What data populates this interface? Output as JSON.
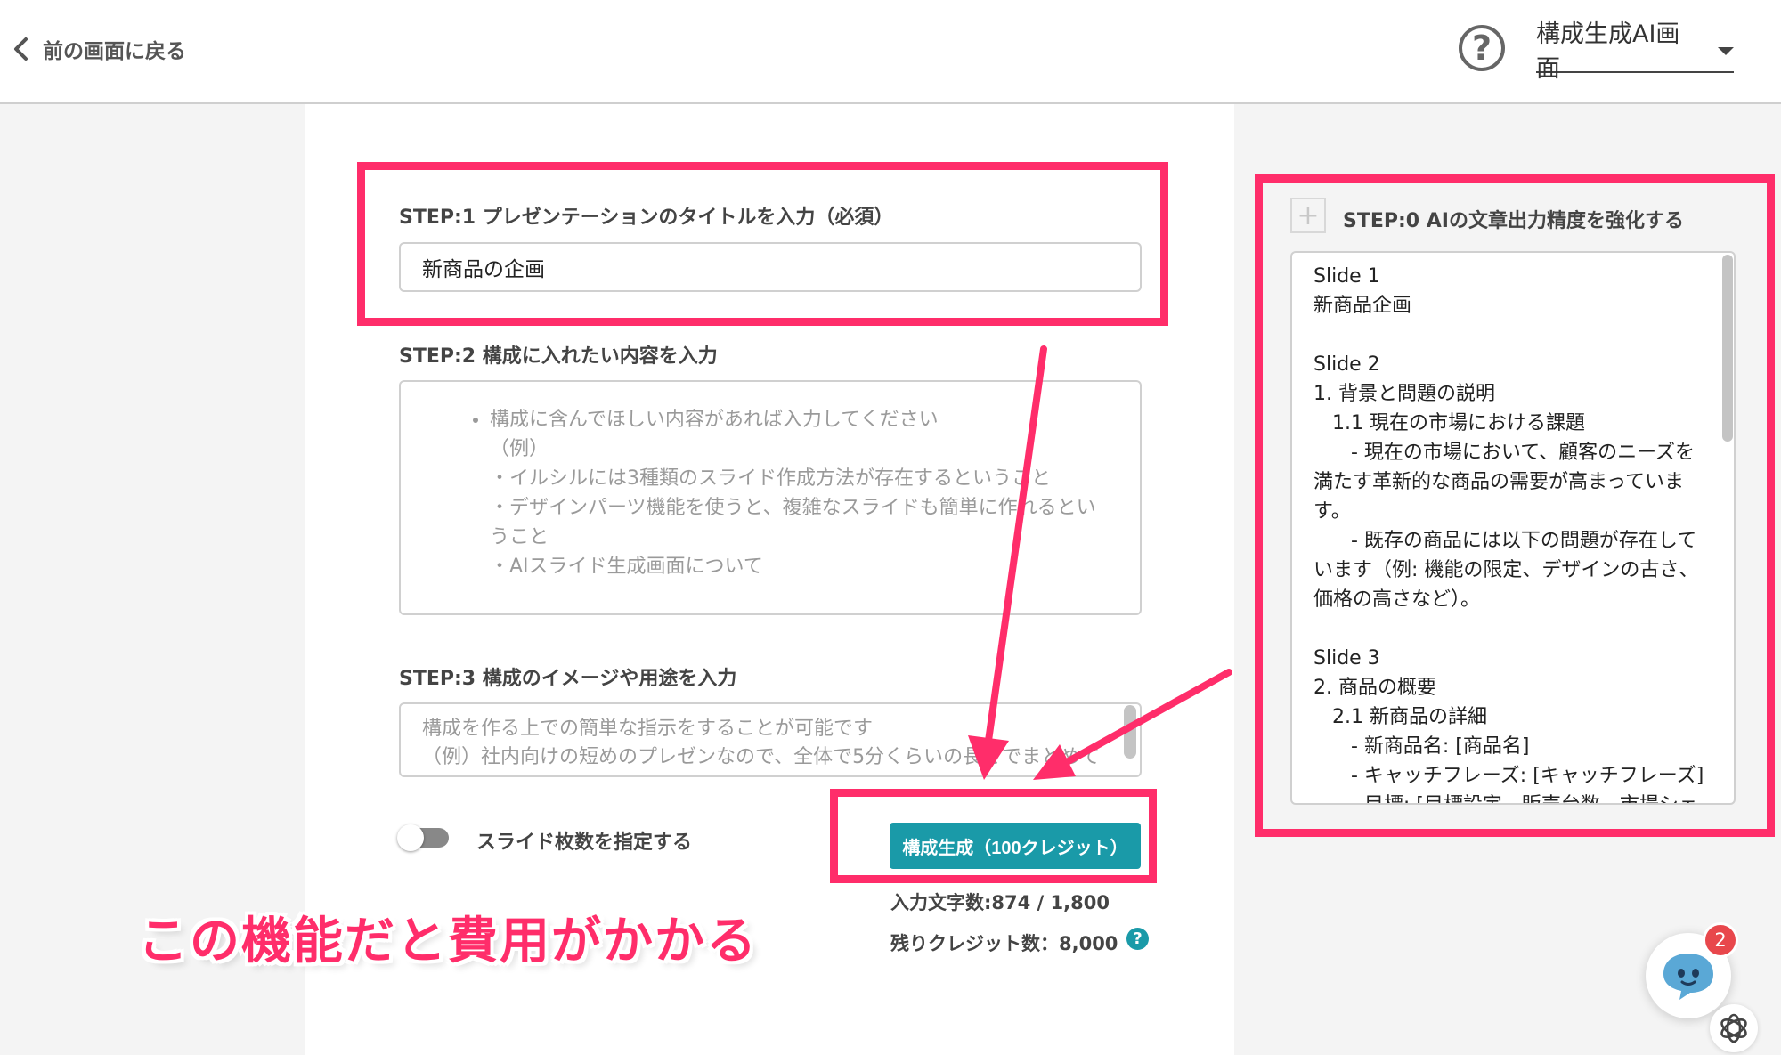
{
  "header": {
    "back_label": "前の画面に戻る",
    "help_symbol": "?",
    "mode_select": "構成生成AI画面"
  },
  "step1": {
    "label": "STEP:1 プレゼンテーションのタイトルを入力（必須）",
    "value": "新商品の企画"
  },
  "step2": {
    "label": "STEP:2 構成に入れたい内容を入力",
    "placeholder": "構成に含んでほしい内容があれば入力してください\n（例）\n・イルシルには3種類のスライド作成方法が存在するということ\n・デザインパーツ機能を使うと、複雑なスライドも簡単に作れるということ\n・AIスライド生成画面について"
  },
  "step3": {
    "label": "STEP:3 構成のイメージや用途を入力",
    "placeholder_line1": "構成を作る上での簡単な指示をすることが可能です",
    "placeholder_line2": "（例）社内向けの短めのプレゼンなので、全体で5分くらいの長さでまとめて"
  },
  "toggle": {
    "label": "スライド枚数を指定する",
    "on": false
  },
  "generate_button": "構成生成（100クレジット）",
  "char_count": "入力文字数:874 / 1,800",
  "credits": "残りクレジット数：8,000",
  "credits_help_symbol": "?",
  "annotation": "この機能だと費用がかかる",
  "step0": {
    "plus_symbol": "+",
    "label": "STEP:0 AIの文章出力精度を強化する",
    "output": "Slide 1\n新商品企画\n\nSlide 2\n1. 背景と問題の説明\n   1.1 現在の市場における課題\n      - 現在の市場において、顧客のニーズを満たす革新的な商品の需要が高まっています。\n      - 既存の商品には以下の問題が存在しています（例: 機能の限定、デザインの古さ、価格の高さなど）。\n\nSlide 3\n2. 商品の概要\n   2.1 新商品の詳細\n      - 新商品名: [商品名]\n      - キャッチフレーズ: [キャッチフレーズ]\n      - 目標: [目標設定、販売台数、市場シェア]"
  },
  "chat_badge": "2",
  "colors": {
    "highlight": "#ff2d6a",
    "button": "#1a9aa8",
    "badge": "#e8474c"
  }
}
